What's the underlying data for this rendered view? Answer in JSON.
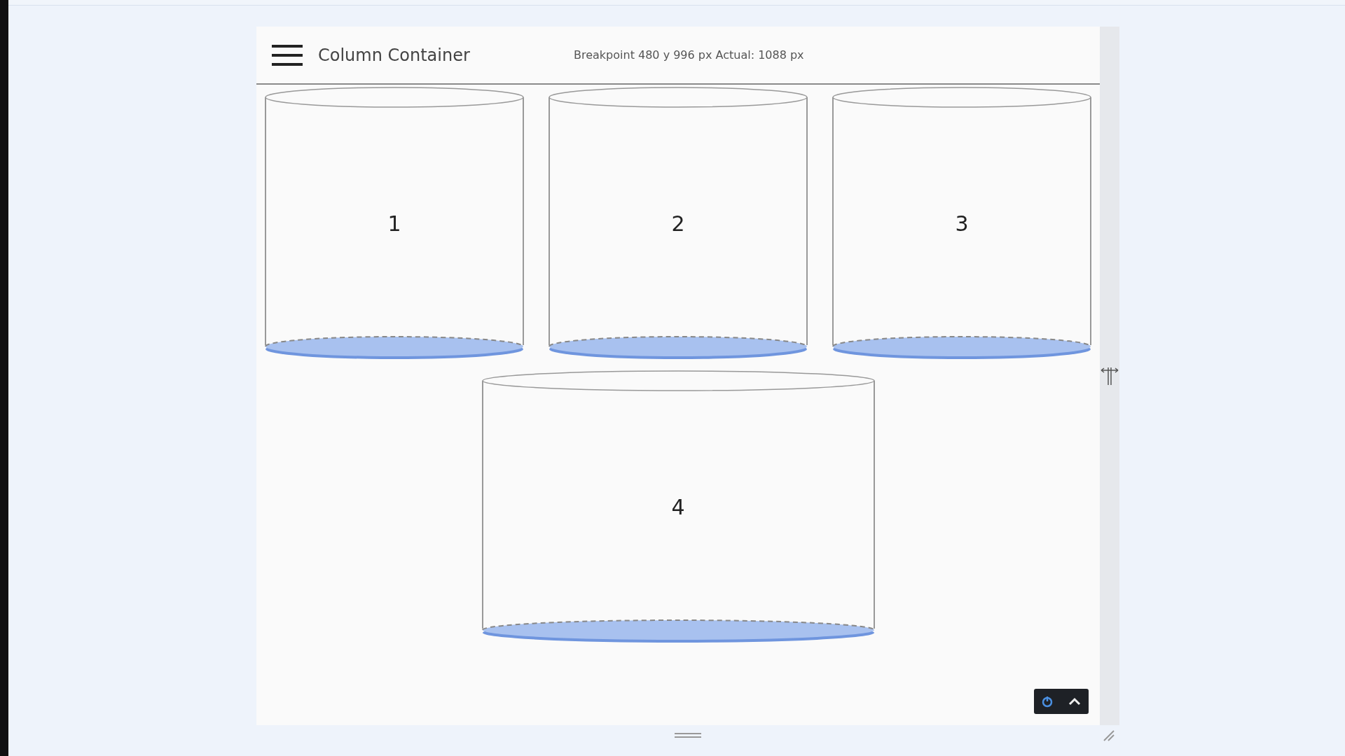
{
  "header": {
    "title": "Column Container",
    "info": "Breakpoint 480 y 996 px Actual: 1088 px"
  },
  "rows": [
    {
      "cylinders": [
        {
          "label": "1",
          "kind": "narrow"
        },
        {
          "label": "2",
          "kind": "narrow"
        },
        {
          "label": "3",
          "kind": "narrow"
        }
      ]
    },
    {
      "cylinders": [
        {
          "label": "4",
          "kind": "wide"
        }
      ]
    }
  ]
}
